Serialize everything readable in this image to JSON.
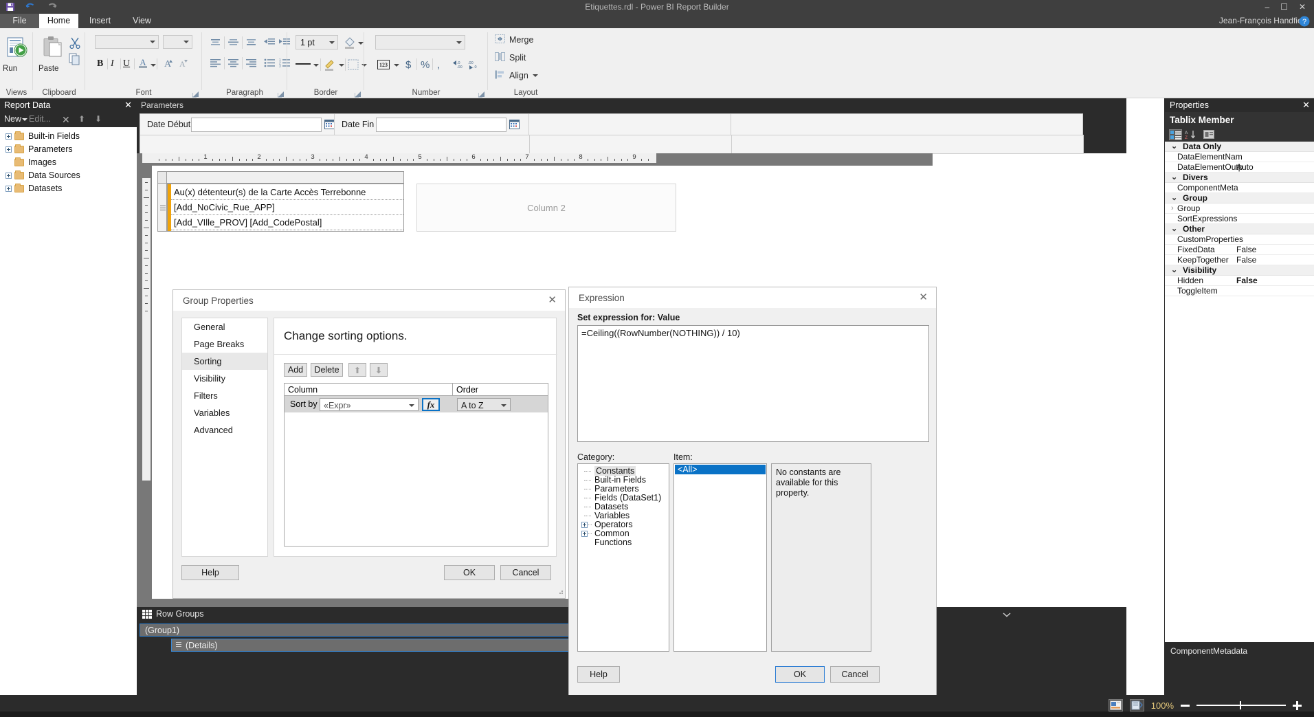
{
  "window": {
    "title": "Etiquettes.rdl - Power BI Report Builder",
    "user": "Jean-François Handfield",
    "help_icon": "question-mark-icon",
    "minimize": "–",
    "maximize": "☐",
    "close": "✕"
  },
  "quick_access": {
    "save": "save-icon",
    "undo": "undo-icon",
    "redo": "redo-icon"
  },
  "tabs": [
    {
      "label": "File",
      "name": "tab-file"
    },
    {
      "label": "Home",
      "name": "tab-home"
    },
    {
      "label": "Insert",
      "name": "tab-insert"
    },
    {
      "label": "View",
      "name": "tab-view"
    }
  ],
  "ribbon": {
    "groups": [
      {
        "label": "Views"
      },
      {
        "label": "Clipboard"
      },
      {
        "label": "Font"
      },
      {
        "label": "Paragraph"
      },
      {
        "label": "Border"
      },
      {
        "label": "Number"
      },
      {
        "label": "Layout"
      }
    ],
    "run_label": "Run",
    "paste_label": "Paste",
    "font_name_value": "",
    "font_size_value": "",
    "border_width_value": "1 pt",
    "number_format_value": "",
    "merge_label": "Merge",
    "split_label": "Split",
    "align_label": "Align"
  },
  "report_data": {
    "title": "Report Data",
    "toolbar": {
      "new": "New",
      "edit": "Edit...",
      "delete": "✕",
      "up": "⬆",
      "down": "⬇"
    },
    "items": [
      {
        "label": "Built-in Fields",
        "expandable": true
      },
      {
        "label": "Parameters",
        "expandable": true
      },
      {
        "label": "Images",
        "expandable": false
      },
      {
        "label": "Data Sources",
        "expandable": true
      },
      {
        "label": "Datasets",
        "expandable": true
      }
    ]
  },
  "parameters_pane": {
    "title": "Parameters",
    "fields": [
      {
        "label": "Date Début",
        "value": "",
        "name": "date-debut-input"
      },
      {
        "label": "Date Fin",
        "value": "",
        "name": "date-fin-input"
      }
    ]
  },
  "design": {
    "ruler_numbers": [
      "1",
      "2",
      "3",
      "4",
      "5",
      "6",
      "7",
      "8",
      "9"
    ],
    "label_lines": [
      "Au(x) détenteur(s) de la Carte Accès Terrebonne",
      "[Add_NoCivic_Rue_APP]",
      "[Add_VIlle_PROV] [Add_CodePostal]"
    ],
    "column2_placeholder": "Column 2"
  },
  "row_groups": {
    "title": "Row Groups",
    "rows": [
      {
        "label": "(Group1)"
      },
      {
        "label": "(Details)"
      }
    ]
  },
  "properties": {
    "title": "Properties",
    "subject": "Tablix Member",
    "sections": [
      {
        "name": "Data Only",
        "rows": [
          {
            "key": "DataElementNam",
            "value": ""
          },
          {
            "key": "DataElementOutp",
            "value": "Auto"
          }
        ]
      },
      {
        "name": "Divers",
        "rows": [
          {
            "key": "ComponentMeta",
            "value": ""
          }
        ]
      },
      {
        "name": "Group",
        "rows": [
          {
            "key": "Group",
            "value": "",
            "expandable": true
          },
          {
            "key": "SortExpressions",
            "value": ""
          }
        ]
      },
      {
        "name": "Other",
        "rows": [
          {
            "key": "CustomProperties",
            "value": ""
          },
          {
            "key": "FixedData",
            "value": "False"
          },
          {
            "key": "KeepTogether",
            "value": "False"
          }
        ]
      },
      {
        "name": "Visibility",
        "rows": [
          {
            "key": "Hidden",
            "value": "False",
            "bold": true
          },
          {
            "key": "ToggleItem",
            "value": ""
          }
        ]
      }
    ],
    "description": "ComponentMetadata"
  },
  "group_properties_dialog": {
    "title": "Group Properties",
    "close": "✕",
    "nav": [
      {
        "label": "General"
      },
      {
        "label": "Page Breaks"
      },
      {
        "label": "Sorting",
        "selected": true
      },
      {
        "label": "Visibility"
      },
      {
        "label": "Filters"
      },
      {
        "label": "Variables"
      },
      {
        "label": "Advanced"
      }
    ],
    "heading": "Change sorting options.",
    "buttons": {
      "add": "Add",
      "delete": "Delete",
      "move_up": "⬆",
      "move_down": "⬇"
    },
    "table": {
      "headers": [
        "Column",
        "Order"
      ],
      "row": {
        "sort_by_label": "Sort by",
        "column_value": "«Expr»",
        "fx_label": "fx",
        "order_value": "A to Z"
      }
    },
    "footer": {
      "help": "Help",
      "ok": "OK",
      "cancel": "Cancel"
    }
  },
  "expression_dialog": {
    "title": "Expression",
    "close": "✕",
    "set_expression_label": "Set expression for: Value",
    "expression_value": "=Ceiling((RowNumber(NOTHING)) / 10)",
    "category_label": "Category:",
    "item_label": "Item:",
    "categories": [
      {
        "label": "Constants",
        "selected": true,
        "expandable": false
      },
      {
        "label": "Built-in Fields",
        "expandable": false
      },
      {
        "label": "Parameters",
        "expandable": false
      },
      {
        "label": "Fields (DataSet1)",
        "expandable": false
      },
      {
        "label": "Datasets",
        "expandable": false
      },
      {
        "label": "Variables",
        "expandable": false
      },
      {
        "label": "Operators",
        "expandable": true
      },
      {
        "label": "Common Functions",
        "expandable": true
      }
    ],
    "items": [
      {
        "label": "<All>",
        "selected": true
      }
    ],
    "description": "No constants are available for this property.",
    "footer": {
      "help": "Help",
      "ok": "OK",
      "cancel": "Cancel"
    }
  },
  "statusbar": {
    "zoom": "100%",
    "design_view_icon": "design-view-icon",
    "print_layout_icon": "print-layout-icon"
  },
  "colors": {
    "accent": "#0a72c6",
    "orange_marker": "#f0a30a",
    "chrome_dark": "#2b2b2b",
    "ribbon_bg": "#f0f0f0"
  }
}
